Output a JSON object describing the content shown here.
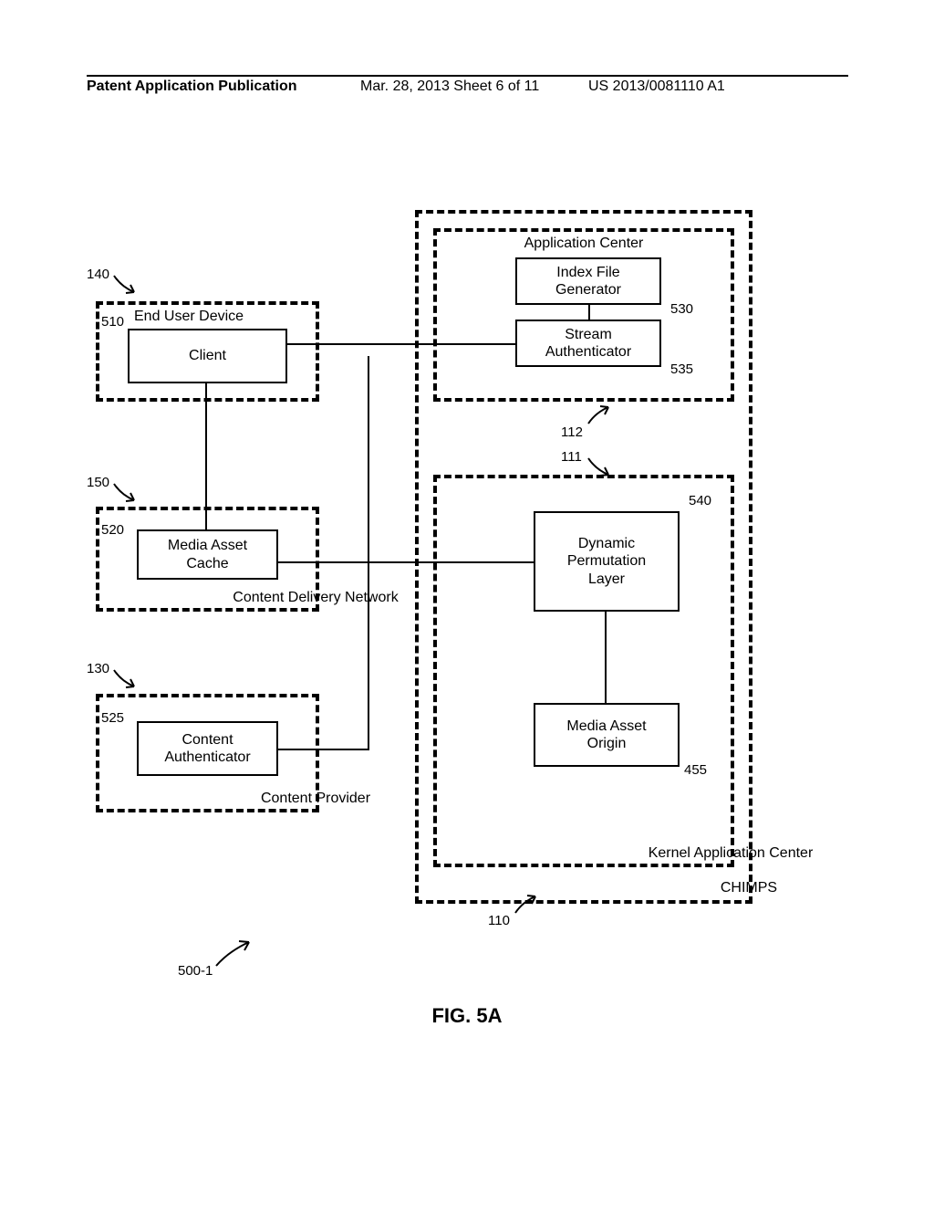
{
  "header": {
    "left": "Patent Application Publication",
    "center": "Mar. 28, 2013  Sheet 6 of 11",
    "right": "US 2013/0081110 A1"
  },
  "figure_label": "FIG. 5A",
  "groups": {
    "end_user_device": "End User Device",
    "content_delivery_network": "Content Delivery Network",
    "content_provider": "Content Provider",
    "application_center": "Application Center",
    "kernel_application_center": "Kernel Application Center",
    "chimps": "CHIMPS"
  },
  "boxes": {
    "client": "Client",
    "media_asset_cache": "Media Asset\nCache",
    "content_authenticator": "Content\nAuthenticator",
    "index_file_generator": "Index File\nGenerator",
    "stream_authenticator": "Stream\nAuthenticator",
    "dynamic_permutation_layer": "Dynamic\nPermutation\nLayer",
    "media_asset_origin": "Media Asset\nOrigin"
  },
  "refs": {
    "r140": "140",
    "r510": "510",
    "r150": "150",
    "r520": "520",
    "r130": "130",
    "r525": "525",
    "r530": "530",
    "r535": "535",
    "r540": "540",
    "r455": "455",
    "r111": "111",
    "r112": "112",
    "r110": "110",
    "r500_1": "500-1"
  },
  "chart_data": {
    "type": "diagram",
    "title": "FIG. 5A",
    "nodes": [
      {
        "id": "140",
        "group": "End User Device"
      },
      {
        "id": "510",
        "label": "Client",
        "parent": "140"
      },
      {
        "id": "150",
        "group": "Content Delivery Network"
      },
      {
        "id": "520",
        "label": "Media Asset Cache",
        "parent": "150"
      },
      {
        "id": "130",
        "group": "Content Provider"
      },
      {
        "id": "525",
        "label": "Content Authenticator",
        "parent": "130"
      },
      {
        "id": "110",
        "group": "CHIMPS"
      },
      {
        "id": "112",
        "group": "Application Center",
        "parent": "110"
      },
      {
        "id": "530",
        "label": "Index File Generator",
        "parent": "112"
      },
      {
        "id": "535",
        "label": "Stream Authenticator",
        "parent": "112"
      },
      {
        "id": "111",
        "group": "Kernel Application Center",
        "parent": "110"
      },
      {
        "id": "540",
        "label": "Dynamic Permutation Layer",
        "parent": "111"
      },
      {
        "id": "455",
        "label": "Media Asset Origin",
        "parent": "111"
      }
    ],
    "edges": [
      {
        "from": "510",
        "to": "535"
      },
      {
        "from": "510",
        "to": "520"
      },
      {
        "from": "520",
        "to": "540"
      },
      {
        "from": "525",
        "to": "540",
        "via": "520"
      },
      {
        "from": "530",
        "to": "535"
      },
      {
        "from": "540",
        "to": "455"
      }
    ],
    "figure_ref": "500-1"
  }
}
